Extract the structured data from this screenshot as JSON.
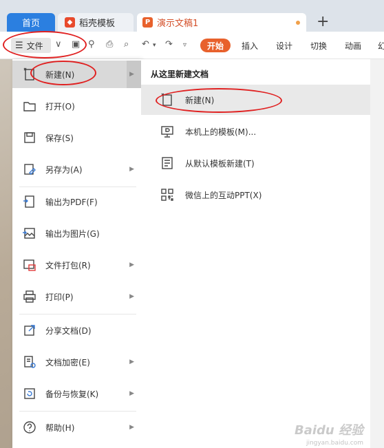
{
  "tabs": {
    "home": "首页",
    "daoke": "稻壳模板",
    "document": "演示文稿1",
    "add": "+"
  },
  "toolbar": {
    "file_label": "文件",
    "ribbon_tabs": [
      "开始",
      "插入",
      "设计",
      "切换",
      "动画",
      "幻"
    ]
  },
  "menu_left": {
    "items": [
      {
        "label": "新建(N)",
        "icon": "new-icon",
        "has_arrow": true
      },
      {
        "label": "打开(O)",
        "icon": "folder-icon",
        "has_arrow": false
      },
      {
        "label": "保存(S)",
        "icon": "save-icon",
        "has_arrow": false
      },
      {
        "label": "另存为(A)",
        "icon": "save-as-icon",
        "has_arrow": true
      },
      {
        "label": "输出为PDF(F)",
        "icon": "pdf-icon",
        "has_arrow": false
      },
      {
        "label": "输出为图片(G)",
        "icon": "image-icon",
        "has_arrow": false
      },
      {
        "label": "文件打包(R)",
        "icon": "package-icon",
        "has_arrow": true
      },
      {
        "label": "打印(P)",
        "icon": "print-icon",
        "has_arrow": true
      },
      {
        "label": "分享文档(D)",
        "icon": "share-icon",
        "has_arrow": false
      },
      {
        "label": "文档加密(E)",
        "icon": "lock-doc-icon",
        "has_arrow": true
      },
      {
        "label": "备份与恢复(K)",
        "icon": "backup-icon",
        "has_arrow": true
      },
      {
        "label": "帮助(H)",
        "icon": "help-icon",
        "has_arrow": true
      }
    ]
  },
  "menu_right": {
    "title": "从这里新建文档",
    "items": [
      {
        "label": "新建(N)",
        "icon": "new-icon"
      },
      {
        "label": "本机上的模板(M)...",
        "icon": "template-icon"
      },
      {
        "label": "从默认模板新建(T)",
        "icon": "default-template-icon"
      },
      {
        "label": "微信上的互动PPT(X)",
        "icon": "qr-code-icon"
      }
    ]
  },
  "watermark": {
    "text": "Baidu 经验",
    "sub": "jingyan.baidu.com"
  },
  "colors": {
    "accent": "#e8612c",
    "home_tab": "#2b7fe0",
    "annotation": "#e02020"
  }
}
